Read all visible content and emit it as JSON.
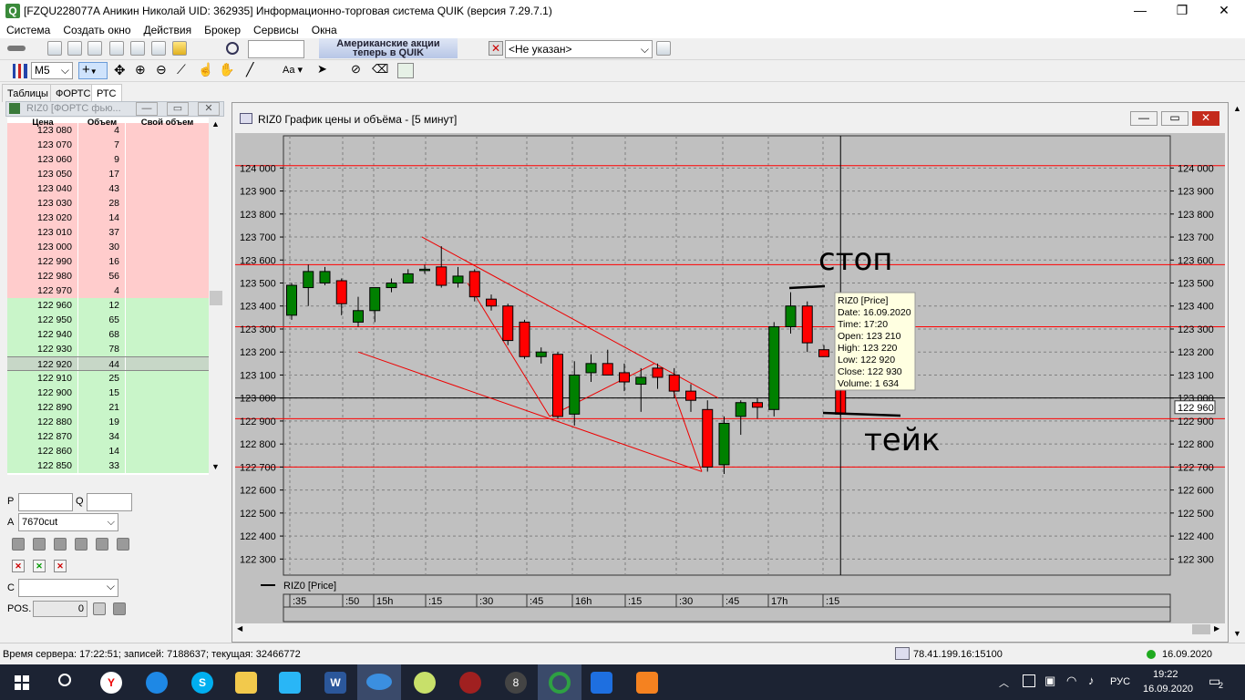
{
  "window": {
    "title": "[FZQU228077A Аникин Николай UID: 362935] Информационно-торговая система QUIK (версия 7.29.7.1)",
    "minimize": "—",
    "maximize": "❐",
    "close": "✕"
  },
  "menu": [
    "Система",
    "Создать окно",
    "Действия",
    "Брокер",
    "Сервисы",
    "Окна"
  ],
  "toolbar": {
    "ad_line1": "Американские акции",
    "ad_line2": "теперь в QUIK",
    "account_select": "<Не указан>",
    "interval_select": "M5",
    "font_label": "Aa"
  },
  "left_tabs": [
    "Таблицы",
    "ФОРТС",
    "РТС"
  ],
  "orderbook": {
    "title": "RIZ0 [ФОРТС фью...",
    "headers": [
      "Цена",
      "Объем",
      "Свой объем"
    ],
    "sell": [
      [
        "123 080",
        "4"
      ],
      [
        "123 070",
        "7"
      ],
      [
        "123 060",
        "9"
      ],
      [
        "123 050",
        "17"
      ],
      [
        "123 040",
        "43"
      ],
      [
        "123 030",
        "28"
      ],
      [
        "123 020",
        "14"
      ],
      [
        "123 010",
        "37"
      ],
      [
        "123 000",
        "30"
      ],
      [
        "122 990",
        "16"
      ],
      [
        "122 980",
        "56"
      ],
      [
        "122 970",
        "4"
      ]
    ],
    "buy": [
      [
        "122 960",
        "12"
      ],
      [
        "122 950",
        "65"
      ],
      [
        "122 940",
        "68"
      ],
      [
        "122 930",
        "78"
      ],
      [
        "122 920",
        "44"
      ],
      [
        "122 910",
        "25"
      ],
      [
        "122 900",
        "15"
      ],
      [
        "122 890",
        "21"
      ],
      [
        "122 880",
        "19"
      ],
      [
        "122 870",
        "34"
      ],
      [
        "122 860",
        "14"
      ],
      [
        "122 850",
        "33"
      ]
    ]
  },
  "order_form": {
    "p_label": "P",
    "q_label": "Q",
    "a_label": "A",
    "a_value": "7670cut",
    "c_label": "C",
    "pos_label": "POS.",
    "pos_value": "0"
  },
  "chart": {
    "window_title": "RIZ0 График цены и объёма - [5 минут]",
    "legend": "RIZ0 [Price]",
    "current_price_label": "122 960",
    "time_labels": [
      ":35",
      ":50",
      "15h",
      ":15",
      ":30",
      ":45",
      "16h",
      ":15",
      ":30",
      ":45",
      "17h",
      ":15"
    ],
    "annotation_stop": "стоп",
    "annotation_take": "тейк",
    "tooltip": {
      "line1": "RIZ0 [Price]",
      "line2": "Date: 16.09.2020",
      "line3": "Time: 17:20",
      "line4": "Open:  123 210",
      "line5": "High:   123 220",
      "line6": "Low:    122 920",
      "line7": "Close: 122 930",
      "line8": "Volume: 1 634"
    }
  },
  "chart_data": {
    "type": "candlestick",
    "ylim": [
      122230,
      124140
    ],
    "y_ticks": [
      124000,
      123900,
      123800,
      123700,
      123600,
      123500,
      123400,
      123300,
      123200,
      123100,
      123000,
      122900,
      122800,
      122700,
      122600,
      122500,
      122400,
      122300
    ],
    "y_tick_labels": [
      "124 000",
      "123 900",
      "123 800",
      "123 700",
      "123 600",
      "123 500",
      "123 400",
      "123 300",
      "123 200",
      "123 100",
      "123 000",
      "122 900",
      "122 800",
      "122 700",
      "122 600",
      "122 500",
      "122 400",
      "122 300"
    ],
    "horizontal_levels": [
      124010,
      123580,
      123310,
      123000,
      122910,
      122700
    ],
    "candles": [
      {
        "o": 123360,
        "h": 123500,
        "l": 123340,
        "c": 123490
      },
      {
        "o": 123480,
        "h": 123580,
        "l": 123400,
        "c": 123550
      },
      {
        "o": 123500,
        "h": 123570,
        "l": 123490,
        "c": 123550
      },
      {
        "o": 123510,
        "h": 123520,
        "l": 123360,
        "c": 123410
      },
      {
        "o": 123330,
        "h": 123440,
        "l": 123310,
        "c": 123380
      },
      {
        "o": 123380,
        "h": 123470,
        "l": 123330,
        "c": 123480
      },
      {
        "o": 123480,
        "h": 123520,
        "l": 123460,
        "c": 123500
      },
      {
        "o": 123500,
        "h": 123560,
        "l": 123500,
        "c": 123540
      },
      {
        "o": 123560,
        "h": 123580,
        "l": 123540,
        "c": 123560
      },
      {
        "o": 123570,
        "h": 123660,
        "l": 123480,
        "c": 123490
      },
      {
        "o": 123500,
        "h": 123570,
        "l": 123480,
        "c": 123530
      },
      {
        "o": 123550,
        "h": 123560,
        "l": 123420,
        "c": 123440
      },
      {
        "o": 123430,
        "h": 123450,
        "l": 123380,
        "c": 123400
      },
      {
        "o": 123400,
        "h": 123410,
        "l": 123230,
        "c": 123250
      },
      {
        "o": 123330,
        "h": 123340,
        "l": 123170,
        "c": 123180
      },
      {
        "o": 123180,
        "h": 123220,
        "l": 123150,
        "c": 123200
      },
      {
        "o": 123190,
        "h": 123200,
        "l": 122910,
        "c": 122920
      },
      {
        "o": 122930,
        "h": 123160,
        "l": 122880,
        "c": 123100
      },
      {
        "o": 123110,
        "h": 123190,
        "l": 123070,
        "c": 123150
      },
      {
        "o": 123150,
        "h": 123210,
        "l": 123100,
        "c": 123100
      },
      {
        "o": 123110,
        "h": 123150,
        "l": 123030,
        "c": 123070
      },
      {
        "o": 123060,
        "h": 123130,
        "l": 122940,
        "c": 123090
      },
      {
        "o": 123130,
        "h": 123150,
        "l": 123040,
        "c": 123090
      },
      {
        "o": 123100,
        "h": 123130,
        "l": 123000,
        "c": 123030
      },
      {
        "o": 123030,
        "h": 123060,
        "l": 122940,
        "c": 122990
      },
      {
        "o": 122950,
        "h": 122990,
        "l": 122680,
        "c": 122700
      },
      {
        "o": 122710,
        "h": 122920,
        "l": 122670,
        "c": 122890
      },
      {
        "o": 122920,
        "h": 122990,
        "l": 122840,
        "c": 122980
      },
      {
        "o": 122980,
        "h": 123000,
        "l": 122910,
        "c": 122960
      },
      {
        "o": 122950,
        "h": 123330,
        "l": 122920,
        "c": 123310
      },
      {
        "o": 123310,
        "h": 123460,
        "l": 123280,
        "c": 123400
      },
      {
        "o": 123400,
        "h": 123420,
        "l": 123200,
        "c": 123240
      },
      {
        "o": 123210,
        "h": 123230,
        "l": 123180,
        "c": 123180
      },
      {
        "o": 123210,
        "h": 123220,
        "l": 122920,
        "c": 122930
      }
    ]
  },
  "status": {
    "server": "Время сервера: 17:22:51; записей: 7188637; текущая: 32466772",
    "connection": "78.41.199.16:15100",
    "date": "16.09.2020"
  },
  "taskbar": {
    "lang": "РУС",
    "time": "19:22",
    "date": "16.09.2020",
    "notif_count": "2"
  },
  "colors": {
    "chart_bg": "#c0c0c0",
    "bull": "#008000",
    "bear": "#ff0000",
    "level_line": "#ff0000",
    "sell_row": "#ffcccc",
    "buy_row": "#c9f5c9"
  }
}
